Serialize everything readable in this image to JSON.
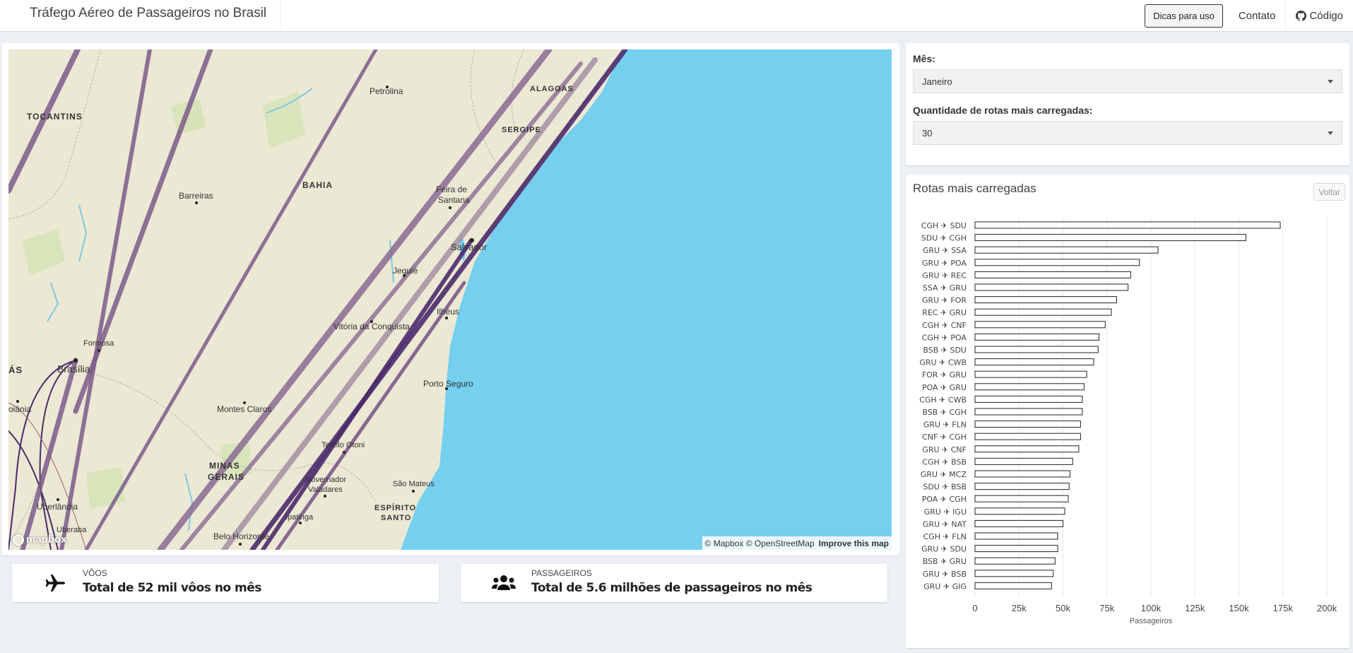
{
  "app": {
    "title": "Tráfego Aéreo de Passageiros no Brasil",
    "tips_button": "Dicas para uso",
    "contact": "Contato",
    "code": "Código"
  },
  "map": {
    "labels": [
      {
        "text": "TOCANTINS",
        "kind": "state"
      },
      {
        "text": "BAHIA",
        "kind": "state"
      },
      {
        "text": "ALAGOAS",
        "kind": "state"
      },
      {
        "text": "SERGIPE",
        "kind": "state"
      },
      {
        "text": "MINAS",
        "kind": "state"
      },
      {
        "text": "GERAIS",
        "kind": "state"
      },
      {
        "text": "ESPÍRITO",
        "kind": "state"
      },
      {
        "text": "SANTO",
        "kind": "state"
      },
      {
        "text": "ÁS",
        "kind": "state"
      },
      {
        "text": "Petrolina",
        "kind": "city"
      },
      {
        "text": "Barreiras",
        "kind": "city"
      },
      {
        "text": "Feira de",
        "kind": "city"
      },
      {
        "text": "Santana",
        "kind": "city"
      },
      {
        "text": "Salvador",
        "kind": "bigcity"
      },
      {
        "text": "Jequié",
        "kind": "city"
      },
      {
        "text": "Vitória da Conquista",
        "kind": "city"
      },
      {
        "text": "Ilhéus",
        "kind": "city"
      },
      {
        "text": "Formosa",
        "kind": "city"
      },
      {
        "text": "Brasília",
        "kind": "bigcity"
      },
      {
        "text": "oiânia",
        "kind": "city"
      },
      {
        "text": "Porto Seguro",
        "kind": "city"
      },
      {
        "text": "Montes Claros",
        "kind": "city"
      },
      {
        "text": "Teófilo Otoni",
        "kind": "city"
      },
      {
        "text": "Governador",
        "kind": "city"
      },
      {
        "text": "Valadares",
        "kind": "city"
      },
      {
        "text": "São Mateus",
        "kind": "city"
      },
      {
        "text": "Uberlândia",
        "kind": "city"
      },
      {
        "text": "Uberaba",
        "kind": "city"
      },
      {
        "text": "Ipatinga",
        "kind": "city"
      },
      {
        "text": "Belo Horizonte",
        "kind": "city"
      }
    ],
    "attribution": "© Mapbox © OpenStreetMap",
    "improve": "Improve this map",
    "logo": "mapbox"
  },
  "stats": {
    "flights_label": "VÔOS",
    "flights_value": "Total de 52 mil vôos no mês",
    "passengers_label": "PASSAGEIROS",
    "passengers_value": "Total de 5.6 milhões de passageiros no mês"
  },
  "controls": {
    "month_label": "Mês:",
    "month_value": "Janeiro",
    "routes_label": "Quantidade de rotas mais carregadas:",
    "routes_value": "30"
  },
  "chart_panel": {
    "title": "Rotas mais carregadas",
    "back_button": "Voltar"
  },
  "chart_data": {
    "type": "bar",
    "orientation": "horizontal",
    "categories": [
      "CGH ✈ SDU",
      "SDU ✈ CGH",
      "GRU ✈ SSA",
      "GRU ✈ POA",
      "GRU ✈ REC",
      "SSA ✈ GRU",
      "GRU ✈ FOR",
      "REC ✈ GRU",
      "CGH ✈ CNF",
      "CGH ✈ POA",
      "BSB ✈ SDU",
      "GRU ✈ CWB",
      "FOR ✈ GRU",
      "POA ✈ GRU",
      "CGH ✈ CWB",
      "BSB ✈ CGH",
      "GRU ✈ FLN",
      "CNF ✈ CGH",
      "GRU ✈ CNF",
      "CGH ✈ BSB",
      "GRU ✈ MCZ",
      "SDU ✈ BSB",
      "POA ✈ CGH",
      "GRU ✈ IGU",
      "GRU ✈ NAT",
      "CGH ✈ FLN",
      "GRU ✈ SDU",
      "BSB ✈ GRU",
      "GRU ✈ BSB",
      "GRU ✈ GIG"
    ],
    "values": [
      173500,
      154000,
      104000,
      93500,
      88500,
      87000,
      80500,
      77500,
      74000,
      70500,
      70000,
      67500,
      63500,
      62000,
      61000,
      61000,
      60000,
      60000,
      59000,
      55500,
      54000,
      53500,
      53000,
      51000,
      50000,
      47000,
      47000,
      45500,
      44500,
      43500
    ],
    "xlabel": "Passageiros",
    "xlim": [
      0,
      200000
    ],
    "xticks": [
      "0",
      "25k",
      "50k",
      "75k",
      "100k",
      "125k",
      "150k",
      "175k",
      "200k"
    ],
    "grid": true,
    "bar_fill": "#ffffff",
    "bar_stroke": "#222222"
  },
  "colors": {
    "route_dark": "#4b2a6b",
    "route_mid": "#7d5a8a",
    "route_light": "#a58fa3",
    "ocean": "#75cfef",
    "land": "#ebe8d4"
  }
}
